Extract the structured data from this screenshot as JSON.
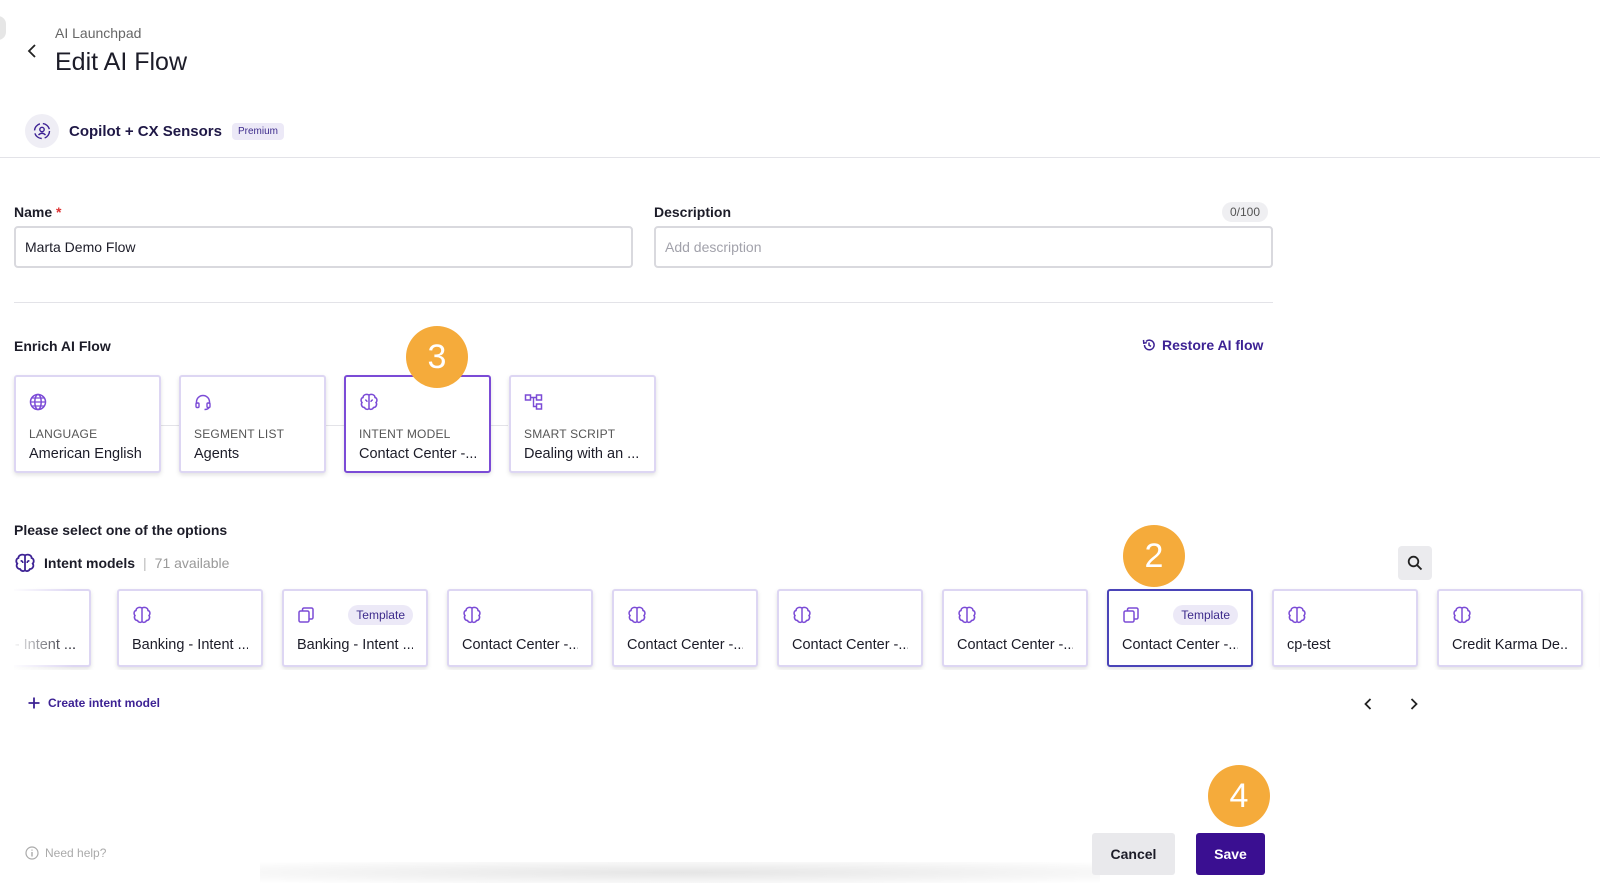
{
  "header": {
    "breadcrumb": "AI Launchpad",
    "title": "Edit AI Flow",
    "product_name": "Copilot + CX Sensors",
    "premium_badge": "Premium"
  },
  "form": {
    "name_label": "Name",
    "name_required_mark": "*",
    "name_value": "Marta Demo Flow",
    "description_label": "Description",
    "description_placeholder": "Add description",
    "description_counter": "0/100"
  },
  "enrich": {
    "title": "Enrich AI Flow",
    "restore_label": "Restore AI flow",
    "steps": [
      {
        "kicker": "LANGUAGE",
        "value": "American English",
        "icon": "globe-icon"
      },
      {
        "kicker": "SEGMENT LIST",
        "value": "Agents",
        "icon": "headset-icon"
      },
      {
        "kicker": "INTENT MODEL",
        "value": "Contact Center -...",
        "icon": "brain-icon",
        "active": true
      },
      {
        "kicker": "SMART SCRIPT",
        "value": "Dealing with an ...",
        "icon": "flow-icon"
      }
    ]
  },
  "options": {
    "prompt": "Please select one of the options",
    "models_title": "Intent models",
    "models_separator": "|",
    "models_count": "71 available",
    "cards": [
      {
        "label": "- Intent ...",
        "icon": "brain-icon"
      },
      {
        "label": "Banking - Intent ...",
        "icon": "brain-icon"
      },
      {
        "label": "Banking - Intent ...",
        "icon": "copy-icon",
        "badge": "Template"
      },
      {
        "label": "Contact Center -...",
        "icon": "brain-icon"
      },
      {
        "label": "Contact Center -...",
        "icon": "brain-icon"
      },
      {
        "label": "Contact Center -...",
        "icon": "brain-icon"
      },
      {
        "label": "Contact Center -...",
        "icon": "brain-icon"
      },
      {
        "label": "Contact Center -...",
        "icon": "copy-icon",
        "badge": "Template",
        "selected": true
      },
      {
        "label": "cp-test",
        "icon": "brain-icon"
      },
      {
        "label": "Credit Karma De...",
        "icon": "brain-icon"
      }
    ],
    "create_label": "Create intent model"
  },
  "annotations": {
    "step2": "2",
    "step3": "3",
    "step4": "4"
  },
  "footer": {
    "help_label": "Need help?",
    "cancel_label": "Cancel",
    "save_label": "Save"
  },
  "colors": {
    "brand": "#3a0f91",
    "accent_purple": "#7b4bd6",
    "annotation_orange": "#f5ab3b",
    "card_border": "#ddd6f3"
  }
}
